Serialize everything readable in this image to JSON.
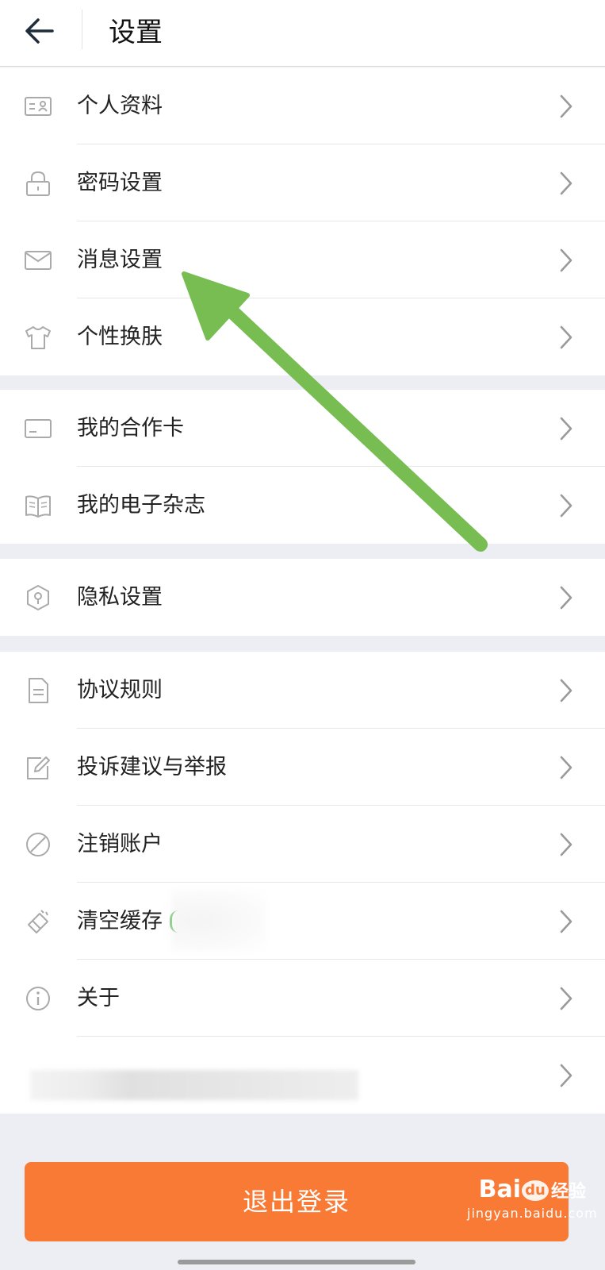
{
  "header": {
    "title": "设置",
    "back_icon": "back-arrow-icon"
  },
  "groups": [
    {
      "items": [
        {
          "label": "个人资料",
          "icon": "id-card-icon"
        },
        {
          "label": "密码设置",
          "icon": "lock-icon"
        },
        {
          "label": "消息设置",
          "icon": "envelope-icon"
        },
        {
          "label": "个性换肤",
          "icon": "tshirt-icon"
        }
      ]
    },
    {
      "items": [
        {
          "label": "我的合作卡",
          "icon": "card-icon"
        },
        {
          "label": "我的电子杂志",
          "icon": "book-icon"
        }
      ]
    },
    {
      "items": [
        {
          "label": "隐私设置",
          "icon": "shield-key-icon"
        }
      ]
    },
    {
      "items": [
        {
          "label": "协议规则",
          "icon": "document-icon"
        },
        {
          "label": "投诉建议与举报",
          "icon": "edit-icon"
        },
        {
          "label": "注销账户",
          "icon": "prohibited-icon"
        },
        {
          "label": "清空缓存",
          "icon": "eraser-icon"
        },
        {
          "label": "关于",
          "icon": "info-icon"
        },
        {
          "label": "",
          "icon": ""
        }
      ]
    }
  ],
  "logout": {
    "label": "退出登录"
  },
  "annotation": {
    "color": "#77bd52",
    "icon": "green-arrow-annotation"
  },
  "watermark": {
    "brand": "Bai",
    "du": "du",
    "jy": "经验",
    "site": "jingyan.baidu.com"
  },
  "colors": {
    "accent": "#f97a35",
    "background": "#eceef3",
    "icon": "#aaaaaa"
  }
}
